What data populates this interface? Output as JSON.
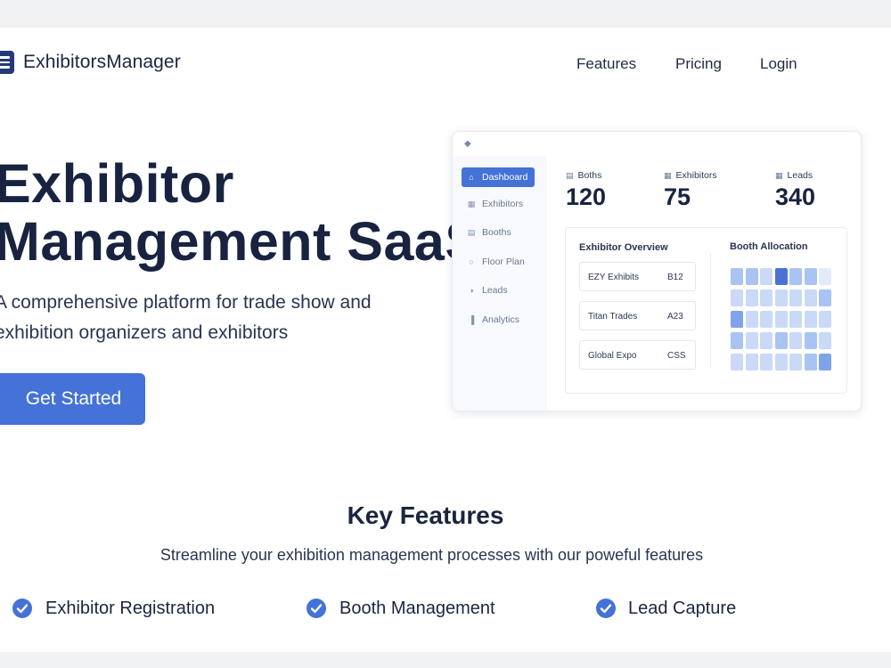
{
  "header": {
    "brand": "ExhibitorsManager",
    "nav": [
      "Features",
      "Pricing",
      "Login"
    ]
  },
  "hero": {
    "title_line1": "Exhibitor",
    "title_line2": "Management SaaS",
    "subtitle": "A comprehensive platform for trade show and exhibition organizers and exhibitors",
    "cta": "Get Started"
  },
  "dashboard": {
    "sidebar": [
      {
        "label": "Dashboard",
        "icon": "home-icon",
        "active": true
      },
      {
        "label": "Exhibitors",
        "icon": "id-card-icon",
        "active": false
      },
      {
        "label": "Booths",
        "icon": "booth-icon",
        "active": false
      },
      {
        "label": "Floor Plan",
        "icon": "map-pin-icon",
        "active": false
      },
      {
        "label": "Leads",
        "icon": "leads-icon",
        "active": false
      },
      {
        "label": "Analytics",
        "icon": "bar-chart-icon",
        "active": false
      }
    ],
    "stats": [
      {
        "label": "Boths",
        "value": "120",
        "icon": "building-icon"
      },
      {
        "label": "Exhibitors",
        "value": "75",
        "icon": "id-card-icon"
      },
      {
        "label": "Leads",
        "value": "340",
        "icon": "leads-icon"
      }
    ],
    "overview_title": "Exhibitor Overview",
    "exhibitors": [
      {
        "name": "EZY Exhibits",
        "booth": "B12"
      },
      {
        "name": "Titan Trades",
        "booth": "A23"
      },
      {
        "name": "Global Expo",
        "booth": "CSS"
      }
    ],
    "allocation_title": "Booth Allocation",
    "allocation_levels": [
      [
        2,
        2,
        1,
        4,
        2,
        2,
        0
      ],
      [
        1,
        1,
        1,
        1,
        1,
        1,
        2
      ],
      [
        3,
        1,
        1,
        1,
        1,
        1,
        1
      ],
      [
        2,
        1,
        1,
        2,
        1,
        2,
        1
      ],
      [
        1,
        1,
        1,
        1,
        1,
        2,
        3
      ]
    ],
    "allocation_colors": [
      "#e3ebfb",
      "#c9d9f7",
      "#a9c3f2",
      "#7fa3e8",
      "#4a72d2"
    ]
  },
  "features": {
    "title": "Key Features",
    "subtitle": "Streamline your exhibition management processes with our poweful features",
    "items": [
      "Exhibitor Registration",
      "Booth Management",
      "Lead Capture"
    ]
  }
}
